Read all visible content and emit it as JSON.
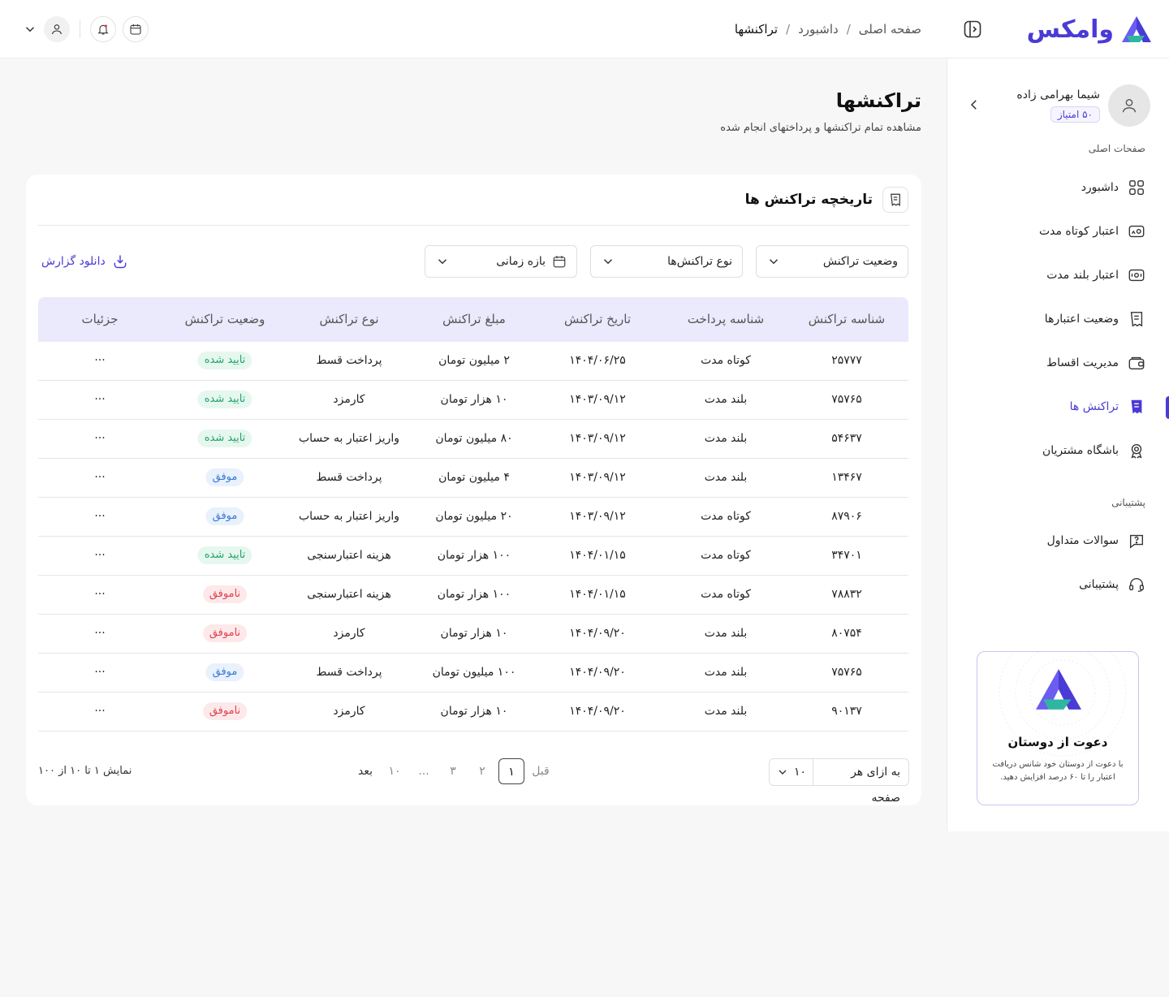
{
  "brand": {
    "name": "وامکس",
    "accent": "#4a3bd6",
    "accent_secondary": "#2fb6a0"
  },
  "header": {
    "breadcrumb": [
      "صفحه اصلی",
      "داشبورد",
      "تراکنشها"
    ],
    "breadcrumb_sep": "/",
    "icons": [
      "calendar-icon",
      "bell-icon",
      "user-icon",
      "chevron-down-icon"
    ]
  },
  "sidebar": {
    "user_name": "شیما بهرامی زاده",
    "points": "۵۰ امتیاز",
    "main_section": "صفحات اصلی",
    "items": [
      {
        "label": "داشبورد",
        "icon": "grid-icon"
      },
      {
        "label": "اعتبار کوتاه مدت",
        "icon": "short-credit-icon"
      },
      {
        "label": "اعتبار بلند مدت",
        "icon": "long-credit-icon"
      },
      {
        "label": "وضعیت اعتبارها",
        "icon": "receipt-icon"
      },
      {
        "label": "مدیریت اقساط",
        "icon": "wallet-icon"
      },
      {
        "label": "تراکنش ها",
        "icon": "transactions-icon",
        "active": true
      },
      {
        "label": "باشگاه مشتریان",
        "icon": "award-icon"
      }
    ],
    "support_section": "پشتیبانی",
    "support_items": [
      {
        "label": "سوالات متداول",
        "icon": "question-icon"
      },
      {
        "label": "پشتیبانی",
        "icon": "headset-icon"
      }
    ],
    "invite": {
      "title": "دعوت از دوستان",
      "desc": "با دعوت از دوستان خود شانس دریافت اعتبار را تا ۶۰ درصد افزایش دهید."
    }
  },
  "main": {
    "title": "تراکنشها",
    "subtitle": "مشاهده تمام تراکنشها و پرداختهای انجام شده",
    "card_title": "تاریخچه تراکنش ها",
    "filters": {
      "status": "وضعیت تراکنش",
      "type": "نوع تراکنش‌ها",
      "date_range": "بازه زمانی"
    },
    "download": "دانلود گزارش",
    "columns": [
      "شناسه تراکنش",
      "شناسه پرداخت",
      "تاریخ تراکنش",
      "مبلغ تراکنش",
      "نوع تراکنش",
      "وضعیت تراکنش",
      "جزئیات"
    ],
    "rows": [
      {
        "id": "۲۵۷۷۷",
        "pay": "کوتاه مدت",
        "date": "۱۴۰۴/۰۶/۲۵",
        "amount": "۲ میلیون تومان",
        "type": "پرداخت قسط",
        "status": "تایید شده",
        "tone": "green",
        "details": "···"
      },
      {
        "id": "۷۵۷۶۵",
        "pay": "بلند مدت",
        "date": "۱۴۰۳/۰۹/۱۲",
        "amount": "۱۰ هزار تومان",
        "type": "کارمزد",
        "status": "تایید شده",
        "tone": "green",
        "details": "···"
      },
      {
        "id": "۵۴۶۳۷",
        "pay": "بلند مدت",
        "date": "۱۴۰۳/۰۹/۱۲",
        "amount": "۸۰ میلیون تومان",
        "type": "واریز اعتبار به حساب",
        "status": "تایید شده",
        "tone": "green",
        "details": "···"
      },
      {
        "id": "۱۳۴۶۷",
        "pay": "بلند مدت",
        "date": "۱۴۰۳/۰۹/۱۲",
        "amount": "۴ میلیون تومان",
        "type": "پرداخت قسط",
        "status": "موفق",
        "tone": "blue",
        "details": "···"
      },
      {
        "id": "۸۷۹۰۶",
        "pay": "کوتاه مدت",
        "date": "۱۴۰۳/۰۹/۱۲",
        "amount": "۲۰ میلیون تومان",
        "type": "واریز اعتبار به حساب",
        "status": "موفق",
        "tone": "blue",
        "details": "···"
      },
      {
        "id": "۳۴۷۰۱",
        "pay": "کوتاه مدت",
        "date": "۱۴۰۴/۰۱/۱۵",
        "amount": "۱۰۰ هزار تومان",
        "type": "هزینه اعتبارسنجی",
        "status": "تایید شده",
        "tone": "green",
        "details": "···"
      },
      {
        "id": "۷۸۸۳۲",
        "pay": "کوتاه مدت",
        "date": "۱۴۰۴/۰۱/۱۵",
        "amount": "۱۰۰ هزار تومان",
        "type": "هزینه اعتبارسنجی",
        "status": "ناموفق",
        "tone": "red",
        "details": "···"
      },
      {
        "id": "۸۰۷۵۴",
        "pay": "بلند مدت",
        "date": "۱۴۰۴/۰۹/۲۰",
        "amount": "۱۰ هزار تومان",
        "type": "کارمزد",
        "status": "ناموفق",
        "tone": "red",
        "details": "···"
      },
      {
        "id": "۷۵۷۶۵",
        "pay": "بلند مدت",
        "date": "۱۴۰۴/۰۹/۲۰",
        "amount": "۱۰۰ میلیون تومان",
        "type": "پرداخت قسط",
        "status": "موفق",
        "tone": "blue",
        "details": "···"
      },
      {
        "id": "۹۰۱۳۷",
        "pay": "بلند مدت",
        "date": "۱۴۰۴/۰۹/۲۰",
        "amount": "۱۰ هزار تومان",
        "type": "کارمزد",
        "status": "ناموفق",
        "tone": "red",
        "details": "···"
      }
    ],
    "pagination": {
      "info": "نمایش ۱ تا ۱۰ از ۱۰۰",
      "prev": "قبل",
      "next": "بعد",
      "pages": [
        "۱",
        "۲",
        "۳",
        "...",
        "۱۰"
      ],
      "current": "۱",
      "per_page_label": "به ازای هر صفحه",
      "per_page_value": "۱۰"
    }
  }
}
